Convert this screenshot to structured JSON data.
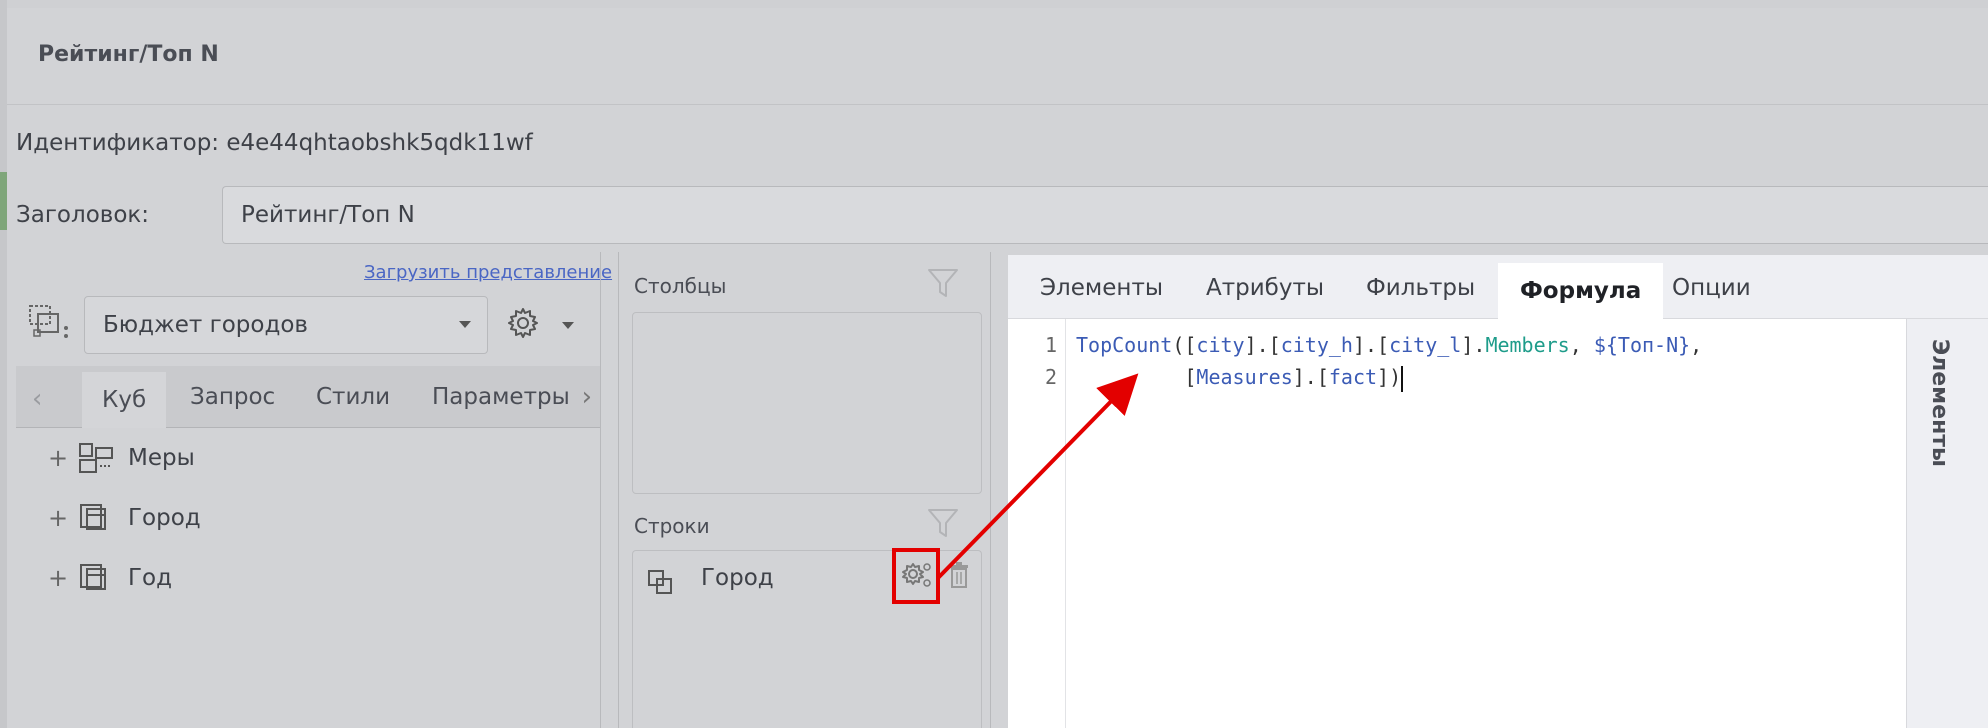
{
  "dialog": {
    "title": "Рейтинг/Топ N",
    "identifier_line": "Идентификатор: e4e44qhtaobshk5qdk11wf",
    "title_label": "Заголовок:",
    "title_value": "Рейтинг/Топ N"
  },
  "left_panel": {
    "load_link": "Загрузить представление",
    "cube_select": "Бюджет городов",
    "tabs": [
      {
        "label": "Куб",
        "active": true
      },
      {
        "label": "Запрос",
        "active": false
      },
      {
        "label": "Стили",
        "active": false
      },
      {
        "label": "Параметры",
        "active": false
      }
    ],
    "tree": [
      {
        "label": "Меры"
      },
      {
        "label": "Город"
      },
      {
        "label": "Год"
      }
    ]
  },
  "middle_panel": {
    "columns_label": "Столбцы",
    "rows_label": "Строки",
    "row_field": "Город"
  },
  "editor": {
    "tabs": [
      {
        "label": "Элементы",
        "active": false
      },
      {
        "label": "Атрибуты",
        "active": false
      },
      {
        "label": "Фильтры",
        "active": false
      },
      {
        "label": "Формула",
        "active": true
      },
      {
        "label": "Опции",
        "active": false
      }
    ],
    "line_numbers": [
      "1",
      "2"
    ],
    "side_panel_label": "Элементы"
  },
  "colors": {
    "highlight": "#e30000",
    "member_color": "#1e9c8a",
    "identifier_color": "#3b5bb5"
  }
}
